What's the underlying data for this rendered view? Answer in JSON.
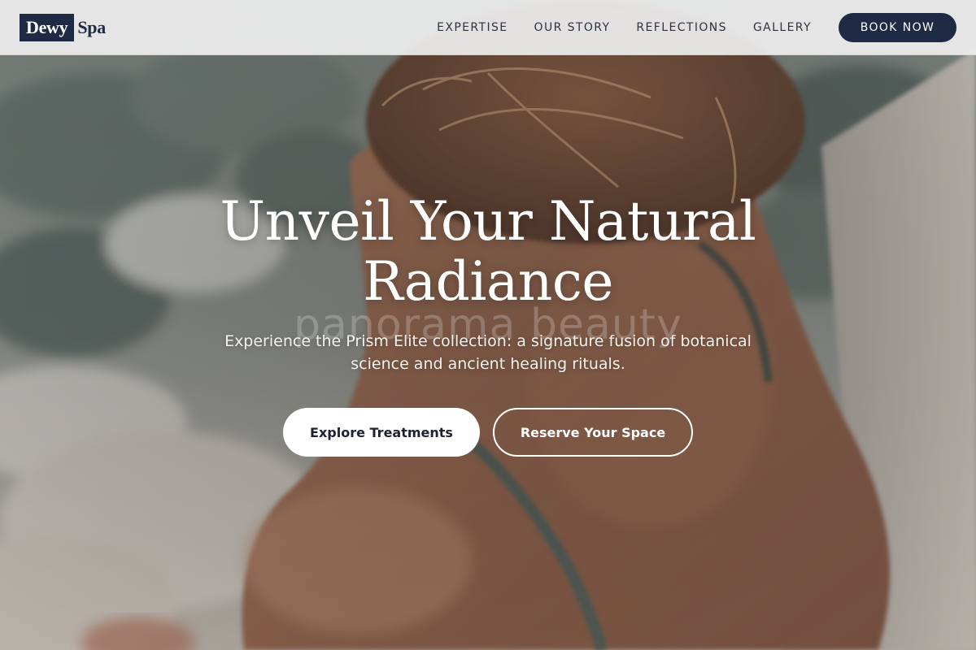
{
  "brand": {
    "logo_mark": "Dewy",
    "logo_text": "Spa"
  },
  "nav": {
    "items": [
      {
        "label": "EXPERTISE"
      },
      {
        "label": "OUR STORY"
      },
      {
        "label": "REFLECTIONS"
      },
      {
        "label": "GALLERY"
      }
    ],
    "cta_label": "BOOK NOW"
  },
  "hero": {
    "title_line1": "Unveil Your Natural",
    "title_line2": "Radiance",
    "watermark": "panorama beauty",
    "subtitle": "Experience the Prism Elite collection: a signature fusion of botanical science and ancient healing rituals.",
    "primary_cta": "Explore Treatments",
    "secondary_cta": "Reserve Your Space"
  },
  "colors": {
    "brand_navy": "#1f2a44",
    "header_bg": "#eeeeee",
    "hero_text": "#ffffff"
  }
}
